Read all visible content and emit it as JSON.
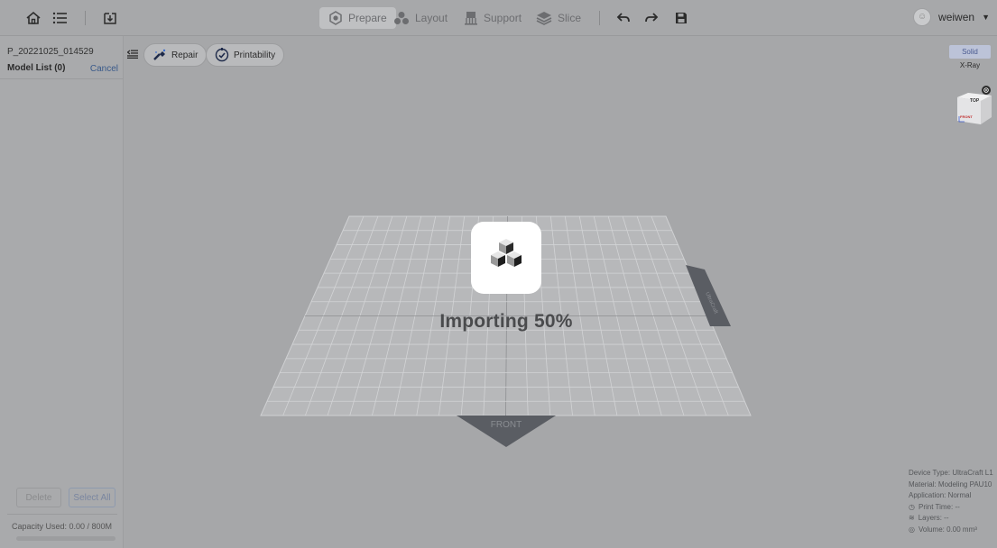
{
  "toolbar": {
    "tabs": [
      {
        "label": "Prepare",
        "icon": "prepare-icon",
        "active": true
      },
      {
        "label": "Layout",
        "icon": "layout-icon",
        "active": false
      },
      {
        "label": "Support",
        "icon": "support-icon",
        "active": false
      },
      {
        "label": "Slice",
        "icon": "slice-icon",
        "active": false
      }
    ],
    "left_icons": [
      "home-icon",
      "menu-icon",
      "import-icon"
    ],
    "right_icons": [
      "undo-icon",
      "redo-icon",
      "save-icon"
    ]
  },
  "user": {
    "name": "weiwen"
  },
  "sidebar": {
    "project_name": "P_20221025_014529",
    "model_list_label": "Model List (0)",
    "cancel_label": "Cancel",
    "delete_label": "Delete",
    "select_all_label": "Select All",
    "capacity_label": "Capacity Used: 0.00 / 800M",
    "capacity_fraction": 0
  },
  "tools": {
    "repair_label": "Repair",
    "printability_label": "Printability"
  },
  "view_mode": {
    "solid_label": "Solid",
    "xray_label": "X-Ray",
    "selected": "Solid"
  },
  "view_cube": {
    "top_label": "TOP",
    "front_label": "FRONT"
  },
  "viewport": {
    "front_label": "FRONT",
    "side_label": "UltraCraft"
  },
  "loading": {
    "text": "Importing 50%",
    "progress_percent": 50
  },
  "info": {
    "device_type": "Device Type: UltraCraft L1",
    "material": "Material: Modeling PAU10",
    "application": "Application: Normal",
    "print_time": "Print Time: --",
    "layers": "Layers: --",
    "volume": "Volume: 0.00 mm³"
  },
  "colors": {
    "accent": "#4a5a90",
    "overlay": "#a6a7a9"
  }
}
